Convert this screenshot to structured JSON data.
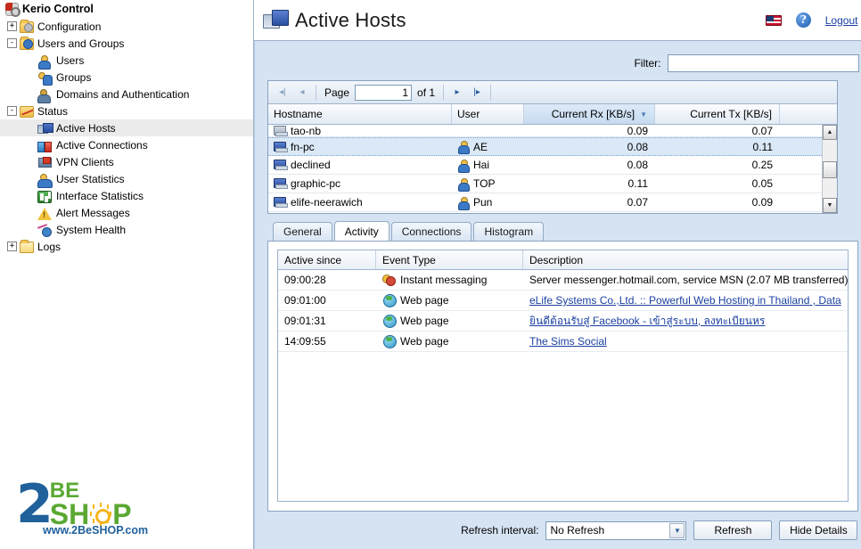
{
  "sidebar": {
    "root_label": "Kerio Control",
    "items": [
      {
        "label": "Configuration",
        "icon": "folder-config-icon",
        "level": 1,
        "twisty": "+",
        "selected": false
      },
      {
        "label": "Users and Groups",
        "icon": "folder-users-icon",
        "level": 1,
        "twisty": "-",
        "selected": false
      },
      {
        "label": "Users",
        "icon": "user-icon",
        "level": 2,
        "twisty": "",
        "selected": false
      },
      {
        "label": "Groups",
        "icon": "users-group-icon",
        "level": 2,
        "twisty": "",
        "selected": false
      },
      {
        "label": "Domains and Authentication",
        "icon": "domain-icon",
        "level": 2,
        "twisty": "",
        "selected": false
      },
      {
        "label": "Status",
        "icon": "status-folder-icon",
        "level": 1,
        "twisty": "-",
        "selected": false
      },
      {
        "label": "Active Hosts",
        "icon": "active-hosts-icon",
        "level": 2,
        "twisty": "",
        "selected": true
      },
      {
        "label": "Active Connections",
        "icon": "active-connections-icon",
        "level": 2,
        "twisty": "",
        "selected": false
      },
      {
        "label": "VPN Clients",
        "icon": "vpn-clients-icon",
        "level": 2,
        "twisty": "",
        "selected": false
      },
      {
        "label": "User Statistics",
        "icon": "user-statistics-icon",
        "level": 2,
        "twisty": "",
        "selected": false
      },
      {
        "label": "Interface Statistics",
        "icon": "interface-statistics-icon",
        "level": 2,
        "twisty": "",
        "selected": false
      },
      {
        "label": "Alert Messages",
        "icon": "alert-messages-icon",
        "level": 2,
        "twisty": "",
        "selected": false
      },
      {
        "label": "System Health",
        "icon": "system-health-icon",
        "level": 2,
        "twisty": "",
        "selected": false
      },
      {
        "label": "Logs",
        "icon": "folder-logs-icon",
        "level": 1,
        "twisty": "+",
        "selected": false
      }
    ],
    "logo": {
      "digit": "2",
      "line1": "BE",
      "line2_left": "SH",
      "line2_right": "P",
      "url": "www.2BeSHOP.com",
      "color_blue": "#20609b",
      "color_green": "#5aa832",
      "color_yellow": "#f5b51c"
    }
  },
  "header": {
    "title": "Active Hosts",
    "title_icon": "active-hosts-icon",
    "flag_icon": "us-flag-icon",
    "help_icon": "help-icon",
    "logout_label": "Logout"
  },
  "filter": {
    "label": "Filter:",
    "value": "",
    "placeholder": ""
  },
  "pager": {
    "first_icon": "◀│",
    "prev_icon": "◀",
    "page_label": "Page",
    "page_value": "1",
    "of_label": "of 1",
    "next_icon": "▶",
    "last_icon": "│▶"
  },
  "hosts_table": {
    "columns": [
      "Hostname",
      "User",
      "Current Rx [KB/s]",
      "Current Tx [KB/s]"
    ],
    "sorted_column": "Current Rx [KB/s]",
    "sort_direction": "desc",
    "rows": [
      {
        "hostname": "tao-nb",
        "user": "",
        "rx": "0.09",
        "tx": "0.07",
        "selected": false,
        "partial": true,
        "icon": "computer-gray-icon"
      },
      {
        "hostname": "fn-pc",
        "user": "AE",
        "rx": "0.08",
        "tx": "0.11",
        "selected": true,
        "partial": false,
        "icon": "computer-icon"
      },
      {
        "hostname": "declined",
        "user": "Hai",
        "rx": "0.08",
        "tx": "0.25",
        "selected": false,
        "partial": false,
        "icon": "computer-icon"
      },
      {
        "hostname": "graphic-pc",
        "user": "TOP",
        "rx": "0.11",
        "tx": "0.05",
        "selected": false,
        "partial": false,
        "icon": "computer-icon"
      },
      {
        "hostname": "elife-neerawich",
        "user": "Pun",
        "rx": "0.07",
        "tx": "0.09",
        "selected": false,
        "partial": false,
        "icon": "computer-icon"
      }
    ]
  },
  "tabs": [
    {
      "label": "General",
      "active": false
    },
    {
      "label": "Activity",
      "active": true
    },
    {
      "label": "Connections",
      "active": false
    },
    {
      "label": "Histogram",
      "active": false
    }
  ],
  "activity_table": {
    "columns": [
      "Active since",
      "Event Type",
      "Description"
    ],
    "rows": [
      {
        "since": "09:00:28",
        "event_type": "Instant messaging",
        "event_icon": "instant-messaging-icon",
        "description": "Server messenger.hotmail.com, service MSN (2.07 MB transferred)",
        "is_link": false
      },
      {
        "since": "09:01:00",
        "event_type": "Web page",
        "event_icon": "web-page-icon",
        "description": "eLife Systems Co.,Ltd. :: Powerful Web Hosting in Thailand , Data",
        "is_link": true
      },
      {
        "since": "09:01:31",
        "event_type": "Web page",
        "event_icon": "web-page-icon",
        "description": "ยินดีต้อนรับสู่ Facebook - เข้าสู่ระบบ, ลงทะเบียนหร",
        "is_link": true
      },
      {
        "since": "14:09:55",
        "event_type": "Web page",
        "event_icon": "web-page-icon",
        "description": "The Sims Social",
        "is_link": true
      }
    ]
  },
  "bottom_bar": {
    "refresh_interval_label": "Refresh interval:",
    "refresh_interval_value": "No Refresh",
    "refresh_button": "Refresh",
    "hide_details_button": "Hide Details"
  },
  "colors": {
    "panel_bg": "#d6e3f3",
    "selection": "#dae8f7",
    "link": "#1a3fa0",
    "border": "#8ba3bf"
  }
}
